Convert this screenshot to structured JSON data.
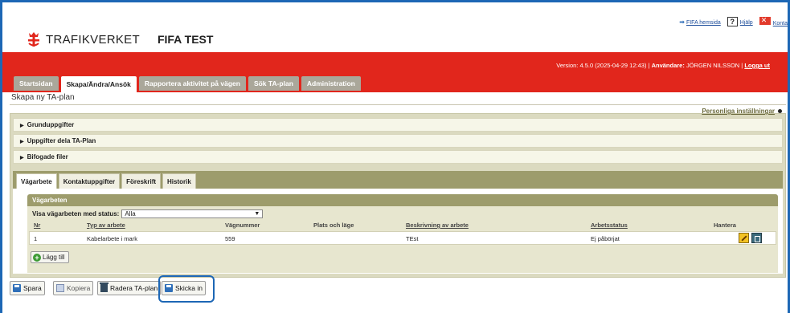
{
  "header": {
    "logo_text": "TRAFIKVERKET",
    "app_name": "FIFA TEST",
    "links": {
      "fifa_home": "FIFA hemsida",
      "help": "Hjälp",
      "contact": "Konta"
    }
  },
  "redband": {
    "version_prefix": "Version: 4.5.0 (2025-04-29 12:43) |",
    "user_label": "Användare:",
    "user_name": "JÖRGEN NILSSON |",
    "logout": "Logga ut"
  },
  "main_tabs": [
    "Startsidan",
    "Skapa/Ändra/Ansök",
    "Rapportera aktivitet på vägen",
    "Sök TA-plan",
    "Administration"
  ],
  "page_title": "Skapa ny TA-plan",
  "settings_link": "Personliga inställningar",
  "sections": [
    "Grunduppgifter",
    "Uppgifter dela TA-Plan",
    "Bifogade filer"
  ],
  "sub_tabs": [
    "Vägarbete",
    "Kontaktuppgifter",
    "Föreskrift",
    "Historik"
  ],
  "vagarbeten": {
    "title": "Vägarbeten",
    "filter_label": "Visa vägarbeten med status:",
    "filter_value": "Alla",
    "columns": [
      "Nr",
      "Typ av arbete",
      "Vägnummer",
      "Plats och läge",
      "Beskrivning av arbete",
      "Arbetsstatus",
      "Hantera"
    ],
    "rows": [
      {
        "nr": "1",
        "typ": "Kabelarbete i mark",
        "vagnummer": "559",
        "plats": "",
        "beskrivning": "TEst",
        "status": "Ej påbörjat"
      }
    ],
    "add_label": "Lägg till"
  },
  "buttons": {
    "save": "Spara",
    "copy": "Kopiera",
    "delete": "Radera TA-plan",
    "submit": "Skicka in"
  },
  "colors": {
    "red_band": "#e1261c",
    "olive": "#9d9c6c",
    "panel_bg": "#dbdac0",
    "frame_blue": "#1d67b5"
  }
}
